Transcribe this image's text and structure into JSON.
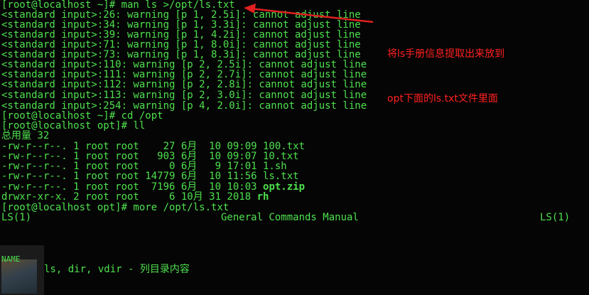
{
  "terminal": {
    "lines": [
      "[root@localhost ~]# man ls >/opt/ls.txt",
      "<standard input>:26: warning [p 1, 2.5i]: cannot adjust line",
      "<standard input>:34: warning [p 1, 3.3i]: cannot adjust line",
      "<standard input>:39: warning [p 1, 4.2i]: cannot adjust line",
      "<standard input>:71: warning [p 1, 8.0i]: cannot adjust line",
      "<standard input>:73: warning [p 1, 8.3i]: cannot adjust line",
      "<standard input>:110: warning [p 2, 2.5i]: cannot adjust line",
      "<standard input>:111: warning [p 2, 2.7i]: cannot adjust line",
      "<standard input>:112: warning [p 2, 2.8i]: cannot adjust line",
      "<standard input>:113: warning [p 2, 3.0i]: cannot adjust line",
      "<standard input>:254: warning [p 4, 2.0i]: cannot adjust line",
      "[root@localhost ~]# cd /opt",
      "[root@localhost opt]# ll",
      "总用量 32",
      "-rw-r--r--. 1 root root    27 6月  10 09:09 100.txt",
      "-rw-r--r--. 1 root root   903 6月  10 09:07 10.txt",
      "-rw-r--r--. 1 root root     0 6月   9 17:01 1.sh",
      "-rw-r--r--. 1 root root 14779 6月  10 11:56 ls.txt",
      "-rw-r--r--. 1 root root  7196 6月  10 10:03 ",
      "drwxr-xr-x. 2 root root     6 10月 31 2018 ",
      "[root@localhost opt]# more /opt/ls.txt"
    ],
    "bold_suffixes": {
      "optzip": "opt.zip",
      "rh": "rh"
    },
    "man_header": {
      "left": "LS(1)",
      "center": "General Commands Manual",
      "right": "LS(1)"
    },
    "section_name": "NAME",
    "description": "ls, dir, vdir - 列目录内容"
  },
  "annotation": {
    "line1": "将ls手册信息提取出来放到",
    "line2": "opt下面的ls.txt文件里面",
    "color": "#ff2020"
  },
  "colors": {
    "background": "#050505",
    "text": "#4ee04e"
  }
}
